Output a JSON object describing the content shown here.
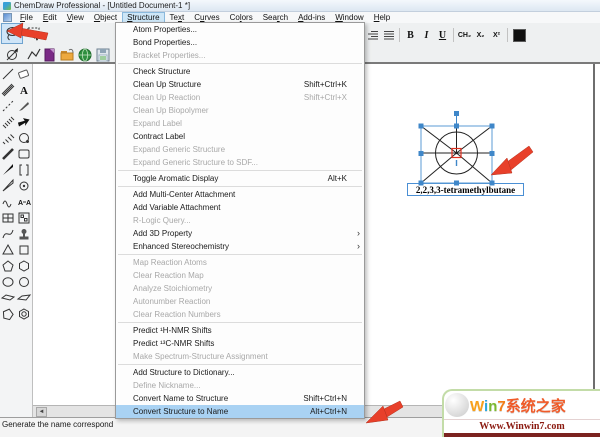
{
  "window": {
    "title": "ChemDraw Professional - [Untitled Document-1 *]"
  },
  "menu_bar": {
    "active": "Structure",
    "items": [
      {
        "label": "File",
        "u": 0
      },
      {
        "label": "Edit",
        "u": 0
      },
      {
        "label": "View",
        "u": 0
      },
      {
        "label": "Object",
        "u": 0
      },
      {
        "label": "Structure",
        "u": 0
      },
      {
        "label": "Text",
        "u": 2
      },
      {
        "label": "Curves",
        "u": 1
      },
      {
        "label": "Colors",
        "u": 2
      },
      {
        "label": "Search",
        "u": 3
      },
      {
        "label": "Add-ins",
        "u": 0
      },
      {
        "label": "Window",
        "u": 0
      },
      {
        "label": "Help",
        "u": 0
      }
    ]
  },
  "toolbar": {
    "tools": [
      "lasso-tool",
      "marquee-tool",
      "rotate-tool",
      "chain-tool"
    ],
    "selected_tool": "lasso-tool",
    "file_buttons": [
      "new-document",
      "open-document",
      "open-from-web",
      "save-document"
    ],
    "format": {
      "align_buttons": [
        "flush-left",
        "justified",
        "flush-right",
        "centered"
      ],
      "bold": "B",
      "italic": "I",
      "underline": "U",
      "formula": "CH₂",
      "subscript": "X₂",
      "superscript": "X²"
    }
  },
  "sidebar": {
    "tools": [
      "solid-bond-tool",
      "eraser-tool",
      "multiple-bond-tool",
      "text-tool",
      "dashed-bond-tool",
      "pen-tool",
      "hashed-bond-tool",
      "arrow-tool",
      "hashed-wedge-tool",
      "orbital-tool",
      "bold-bond-tool",
      "rectangle-tool",
      "wedge-bond-tool",
      "bracket-tool",
      "hollow-wedge-tool",
      "chemical-symbol-tool",
      "wavy-bond-tool",
      "reaction-map-tool",
      "table-tool",
      "template-tool",
      "curve-tool",
      "stamp-tool",
      "cyclopropane-ring-tool",
      "cyclobutane-ring-tool",
      "cyclopentane-ring-tool",
      "cyclohexane-ring-tool",
      "cyclooctane-ring-tool",
      "circle-ring-tool",
      "chair-cyclohexane-tool",
      "chair-cyclohexane-alt-tool",
      "cyclopentadiene-ring-tool",
      "benzene-ring-tool"
    ]
  },
  "structure_menu": {
    "title": "Structure",
    "items": [
      {
        "label": "Atom Properties...",
        "shortcut": "",
        "state": "normal"
      },
      {
        "label": "Bond Properties...",
        "shortcut": "",
        "state": "normal"
      },
      {
        "label": "Bracket Properties...",
        "shortcut": "",
        "state": "disabled"
      },
      {
        "separator": true
      },
      {
        "label": "Check Structure",
        "shortcut": "",
        "state": "normal"
      },
      {
        "label": "Clean Up Structure",
        "shortcut": "Shift+Ctrl+K",
        "state": "normal"
      },
      {
        "label": "Clean Up Reaction",
        "shortcut": "Shift+Ctrl+X",
        "state": "disabled"
      },
      {
        "label": "Clean Up Biopolymer",
        "shortcut": "",
        "state": "disabled"
      },
      {
        "label": "Expand Label",
        "shortcut": "",
        "state": "disabled"
      },
      {
        "label": "Contract Label",
        "shortcut": "",
        "state": "normal"
      },
      {
        "label": "Expand Generic Structure",
        "shortcut": "",
        "state": "disabled"
      },
      {
        "label": "Expand Generic Structure to SDF...",
        "shortcut": "",
        "state": "disabled"
      },
      {
        "separator": true
      },
      {
        "label": "Toggle Aromatic Display",
        "shortcut": "Alt+K",
        "state": "normal"
      },
      {
        "separator": true
      },
      {
        "label": "Add Multi-Center Attachment",
        "shortcut": "",
        "state": "normal"
      },
      {
        "label": "Add Variable Attachment",
        "shortcut": "",
        "state": "normal"
      },
      {
        "label": "R-Logic Query...",
        "shortcut": "",
        "state": "disabled"
      },
      {
        "label": "Add 3D Property",
        "shortcut": "",
        "state": "normal",
        "submenu": true
      },
      {
        "label": "Enhanced Stereochemistry",
        "shortcut": "",
        "state": "normal",
        "submenu": true
      },
      {
        "separator": true
      },
      {
        "label": "Map Reaction Atoms",
        "shortcut": "",
        "state": "disabled"
      },
      {
        "label": "Clear Reaction Map",
        "shortcut": "",
        "state": "disabled"
      },
      {
        "label": "Analyze Stoichiometry",
        "shortcut": "",
        "state": "disabled"
      },
      {
        "label": "Autonumber Reaction",
        "shortcut": "",
        "state": "disabled"
      },
      {
        "label": "Clear Reaction Numbers",
        "shortcut": "",
        "state": "disabled"
      },
      {
        "separator": true
      },
      {
        "label": "Predict ¹H-NMR Shifts",
        "shortcut": "",
        "state": "normal"
      },
      {
        "label": "Predict ¹³C-NMR Shifts",
        "shortcut": "",
        "state": "normal"
      },
      {
        "label": "Make Spectrum-Structure Assignment",
        "shortcut": "",
        "state": "disabled"
      },
      {
        "separator": true
      },
      {
        "label": "Add Structure to Dictionary...",
        "shortcut": "",
        "state": "normal"
      },
      {
        "label": "Define Nickname...",
        "shortcut": "",
        "state": "disabled"
      },
      {
        "label": "Convert Name to Structure",
        "shortcut": "Shift+Ctrl+N",
        "state": "normal"
      },
      {
        "label": "Convert Structure to Name",
        "shortcut": "Alt+Ctrl+N",
        "state": "selected"
      }
    ]
  },
  "canvas": {
    "molecule_label": "2,2,3,3-tetramethylbutane"
  },
  "status_bar": {
    "text": "Generate the name correspond"
  },
  "watermark": {
    "brand": [
      {
        "t": "W",
        "c": "#f9a11b"
      },
      {
        "t": "i",
        "c": "#2ba7df"
      },
      {
        "t": "n",
        "c": "#7cb82f"
      },
      {
        "t": "7",
        "c": "#f57f17"
      },
      {
        "t": "系统之家",
        "c": "#f05a28"
      }
    ],
    "url": "Www.Winwin7.com"
  },
  "colors": {
    "menu_highlight": "#a9d2f3",
    "selection_blue": "#3f87c9",
    "annotation_red": "#e8402a",
    "atom_highlight_red": "#e03020"
  }
}
